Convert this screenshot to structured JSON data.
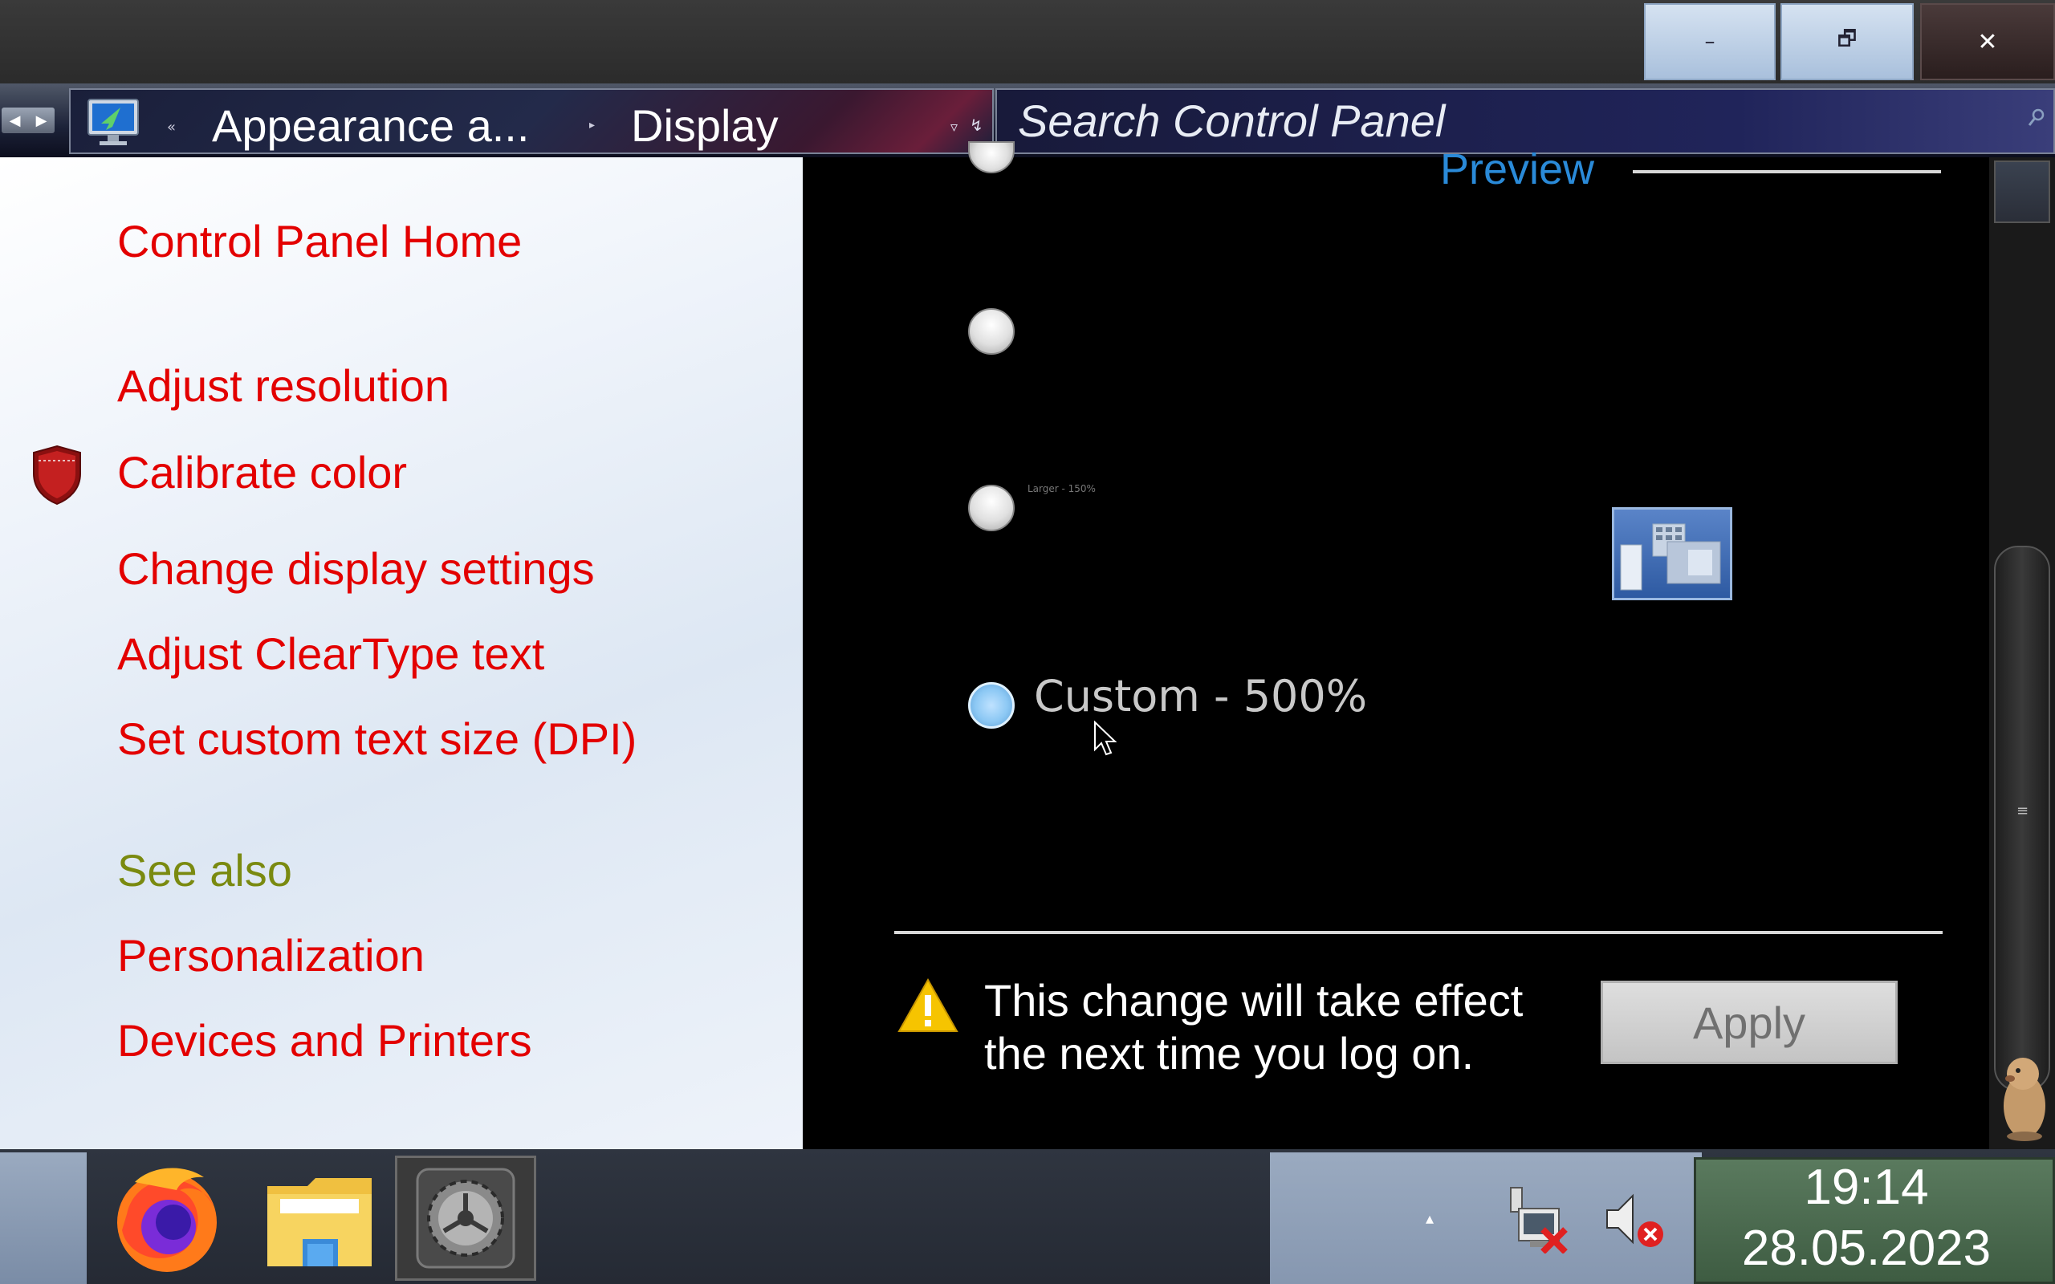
{
  "window": {
    "minimize_glyph": "–",
    "restore_glyph": "🗗",
    "close_glyph": "✕"
  },
  "nav": {
    "back_glyph": "◀",
    "forward_glyph": "▶",
    "breadcrumb": [
      "Appearance a...",
      "Display"
    ],
    "breadcrumb_sep": "«",
    "dropdown_glyph": "▿",
    "refresh_glyph": "↯"
  },
  "search": {
    "placeholder": "Search Control Panel",
    "icon": "search-icon"
  },
  "sidebar": {
    "home": "Control Panel Home",
    "tasks": [
      {
        "label": "Adjust resolution",
        "icon": null
      },
      {
        "label": "Calibrate color",
        "icon": "shield-icon"
      },
      {
        "label": "Change display settings",
        "icon": null
      },
      {
        "label": "Adjust ClearType text",
        "icon": null
      },
      {
        "label": "Set custom text size (DPI)",
        "icon": null
      }
    ],
    "see_also_heading": "See also",
    "see_also": [
      "Personalization",
      "Devices and Printers"
    ]
  },
  "main": {
    "preview_label": "Preview",
    "options": [
      {
        "label": "",
        "selected": false
      },
      {
        "label": "",
        "selected": false
      },
      {
        "label": "Larger - 150%",
        "selected": false
      },
      {
        "label": "Custom - 500%",
        "selected": true
      }
    ],
    "warning_text_line1": "This change will take effect",
    "warning_text_line2": "the next time you log on.",
    "apply_label": "Apply"
  },
  "taskbar": {
    "apps": [
      "firefox-icon",
      "file-explorer-icon",
      "settings-icon"
    ],
    "tray": {
      "chevron": "▴",
      "icons": [
        "network-disconnected-icon",
        "volume-muted-icon"
      ]
    },
    "clock": {
      "time": "19:14",
      "date": "28.05.2023"
    }
  },
  "colors": {
    "link": "#e30000",
    "see_also": "#7a8a10",
    "preview_heading": "#2a8ad8",
    "clock_bg": "#4a6a4e"
  }
}
